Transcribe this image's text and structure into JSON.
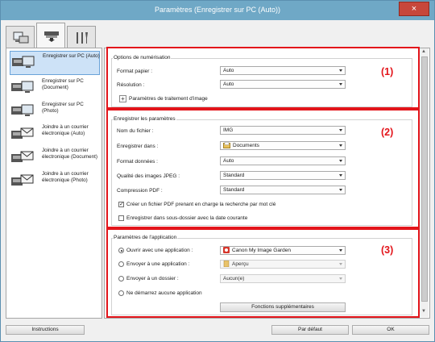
{
  "window": {
    "title": "Paramètres (Enregistrer sur PC (Auto))",
    "close_glyph": "×"
  },
  "tabs": [
    {
      "icon": "scan-from-computer-icon"
    },
    {
      "icon": "scan-from-panel-icon",
      "active": true
    },
    {
      "icon": "general-settings-icon"
    }
  ],
  "sidebar": {
    "items": [
      {
        "label": "Enregistrer sur PC (Auto)",
        "icon": "save-to-pc-icon",
        "selected": true
      },
      {
        "label": "Enregistrer sur PC (Document)",
        "icon": "save-to-pc-icon"
      },
      {
        "label": "Enregistrer sur PC (Photo)",
        "icon": "save-to-pc-icon"
      },
      {
        "label": "Joindre à un courrier électronique (Auto)",
        "icon": "attach-email-icon"
      },
      {
        "label": "Joindre à un courrier électronique (Document)",
        "icon": "attach-email-icon"
      },
      {
        "label": "Joindre à un courrier électronique (Photo)",
        "icon": "attach-email-icon"
      }
    ]
  },
  "scan_options": {
    "title": "Options de numérisation",
    "paper_size_label": "Format papier :",
    "paper_size_value": "Auto",
    "resolution_label": "Résolution :",
    "resolution_value": "Auto",
    "image_processing_label": "Paramètres de traitement d'image",
    "marker": "(1)"
  },
  "save_settings": {
    "title": "Enregistrer les paramètres",
    "filename_label": "Nom du fichier :",
    "filename_value": "IMG",
    "save_in_label": "Enregistrer dans :",
    "save_in_value": "Documents",
    "data_format_label": "Format données :",
    "data_format_value": "Auto",
    "jpeg_quality_label": "Qualité des images JPEG :",
    "jpeg_quality_value": "Standard",
    "pdf_compression_label": "Compression PDF :",
    "pdf_compression_value": "Standard",
    "searchable_pdf_label": "Créer un fichier PDF prenant en charge la recherche par mot clé",
    "searchable_pdf_checked": true,
    "subfolder_label": "Enregistrer dans sous-dossier avec la date courante",
    "subfolder_checked": false,
    "check_glyph": "✓",
    "marker": "(2)"
  },
  "app_settings": {
    "title": "Paramètres de l'application",
    "open_app_label": "Ouvrir avec une application :",
    "open_app_value": "Canon My Image Garden",
    "send_app_label": "Envoyer à une application :",
    "send_app_value": "Aperçu",
    "send_folder_label": "Envoyer à un dossier :",
    "send_folder_value": "Aucun(e)",
    "no_app_label": "Ne démarrez aucune application",
    "more_functions_label": "Fonctions supplémentaires",
    "selected_option": "open_app",
    "marker": "(3)"
  },
  "footer": {
    "instructions_label": "Instructions",
    "defaults_label": "Par défaut",
    "ok_label": "OK"
  },
  "colors": {
    "accent_red": "#e3151b",
    "title_bar": "#6fa8c6",
    "selection": "#cde2f7"
  }
}
